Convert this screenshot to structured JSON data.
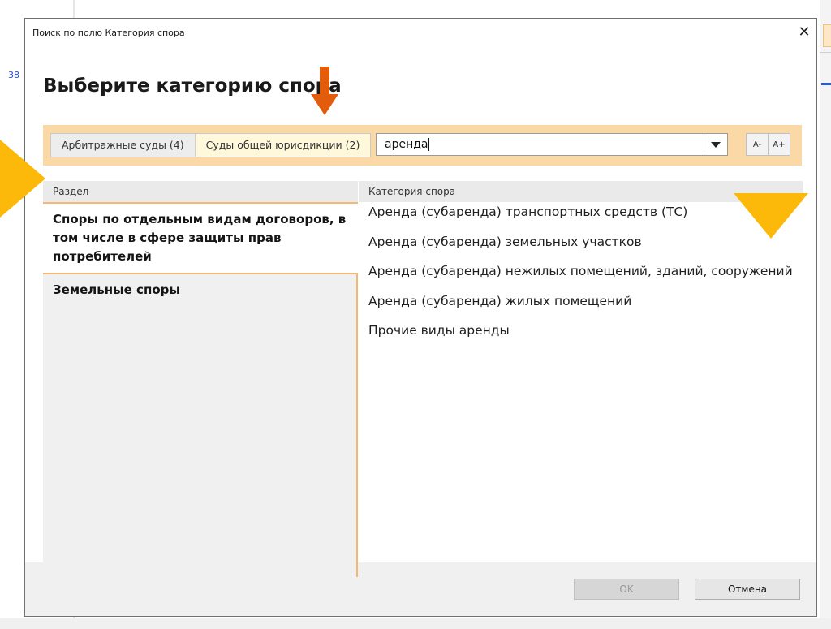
{
  "background": {
    "left_link": "38"
  },
  "dialog": {
    "title": "Поиск по полю Категория спора",
    "close_label": "✕",
    "heading": "Выберите категорию спора",
    "tabs": [
      {
        "label": "Арбитражные суды (4)",
        "active": false
      },
      {
        "label": "Суды общей юрисдикции (2)",
        "active": true
      }
    ],
    "search": {
      "value": "аренда"
    },
    "font_buttons": {
      "decrease": "A-",
      "increase": "A+"
    },
    "columns": {
      "section": "Раздел",
      "category": "Категория спора"
    },
    "sections": [
      {
        "label": "Споры по отдельным видам договоров, в том числе в сфере защиты прав потребителей",
        "selected": true
      },
      {
        "label": "Земельные споры",
        "selected": false
      }
    ],
    "categories": [
      "Аренда (субаренда) транспортных средств (ТС)",
      "Аренда (субаренда) земельных участков",
      "Аренда (субаренда) нежилых помещений, зданий, сооружений",
      "Аренда (субаренда) жилых помещений",
      "Прочие виды аренды"
    ],
    "ok_label": "OK",
    "cancel_label": "Отмена"
  },
  "colors": {
    "toolbar_bg": "#fbd9a6",
    "selection_border": "#f3b874",
    "annotation_orange": "#e25c0c",
    "annotation_yellow": "#fcb90a"
  }
}
